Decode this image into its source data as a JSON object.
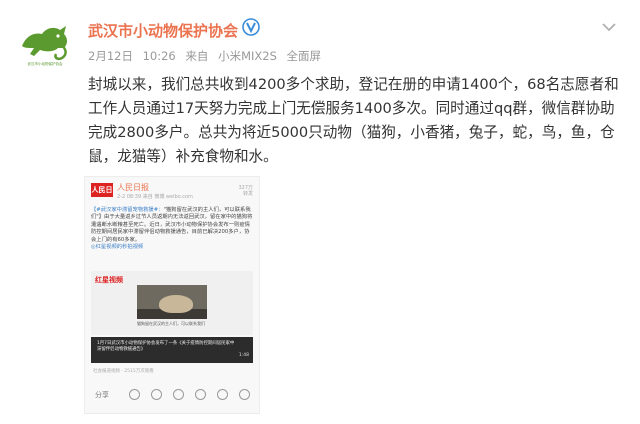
{
  "account": {
    "name": "武汉市小动物保护协会",
    "avatar_subtitle": "武汉市小动物保护协会",
    "brand_color": "#eb7350",
    "avatar_color": "#5b9a2f"
  },
  "meta": {
    "date": "2月12日",
    "time": "10:26",
    "source_prefix": "来自",
    "device": "小米MIX2S",
    "device_extra": "全面屏"
  },
  "post": {
    "lines": [
      "封城以来，我们总共收到4200多个求助，登记在册的申请1400个，68名志愿者和",
      "工作人员通过17天努力完成上门无偿服务1400多次。同时通过qq群，微信群协助",
      "完成2800多户。总共为将近5000只动物（猫狗，小香猪，兔子，蛇，鸟，鱼，仓",
      "鼠，龙猫等）补充食物和水。"
    ]
  },
  "card": {
    "logo": "人民日报",
    "name": "人民日报",
    "time": "2-2 08:39  来自 微博 weibo.com",
    "count_top": "327万",
    "count_bottom": "转发",
    "text_tag": "【#武汉家中滞留宠物救援#：",
    "text_body": "\"猫狗留在武汉的主人们，可以联系我们\"】由于大量返乡过节人员返期内无法返回武汉，留在家中的猫狗将遭遇断水断粮甚至死亡。近日，武汉市小动物保护协会发布一则疫情防控期间居民家中滞留伴侣动物救援通告，目前已解决200多户，协会上门的有60多家。",
    "text_link": "◎红星视频的秒拍视频",
    "video_logo": "红星视频",
    "video_caption": "猫狗留在武汉的主人们，可以联系我们",
    "dark_text": "1月7日武汉市小动物保护协会发布了一条《关于疫情防控期间居民家中滞留伴侣动物救援通告》",
    "duration": "1:48",
    "views": "社会报道视频 · 2515万次观看",
    "share_label": "分享"
  }
}
